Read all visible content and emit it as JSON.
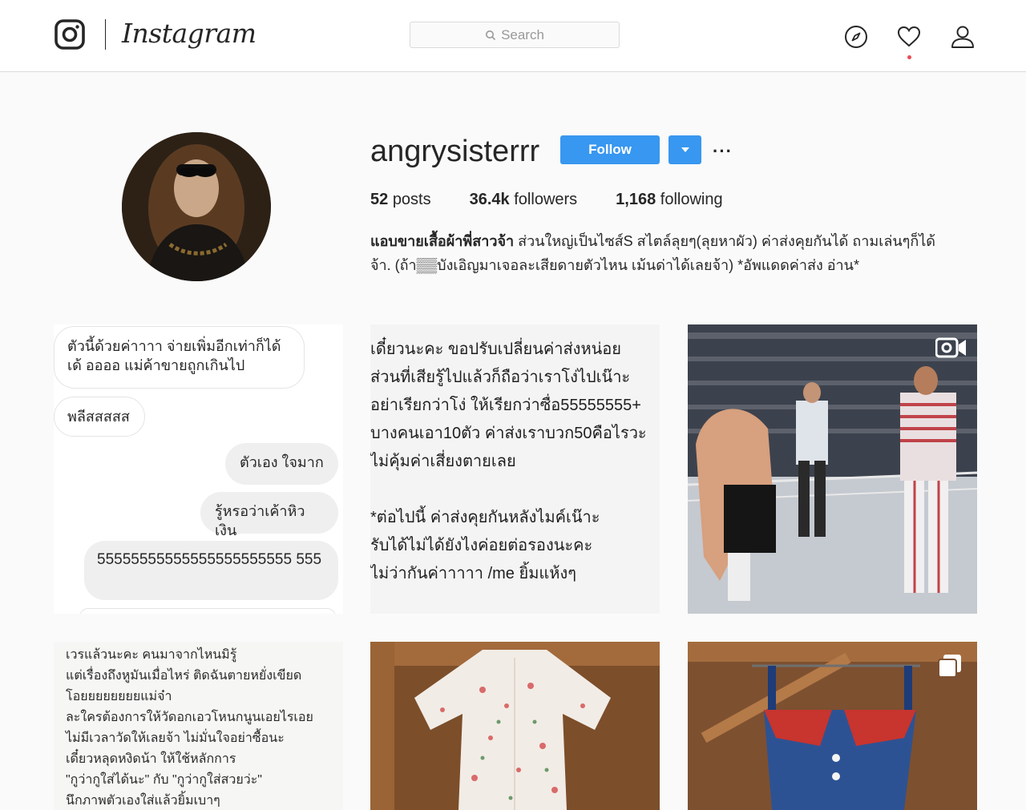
{
  "header": {
    "brand": "Instagram",
    "search_placeholder": "Search",
    "icons": [
      "compass-icon",
      "heart-icon",
      "profile-icon"
    ],
    "accent_color": "#3897f0",
    "notification_color": "#ed4956"
  },
  "profile": {
    "username": "angrysisterrr",
    "follow_label": "Follow",
    "more_label": "···",
    "stats": {
      "posts_count": "52",
      "posts_label": "posts",
      "followers_count": "36.4k",
      "followers_label": "followers",
      "following_count": "1,168",
      "following_label": "following"
    },
    "bio_name": "แอบขายเสื้อผ้าพี่สาวจ้า",
    "bio_line1_rest": " ส่วนใหญ่เป็นไซส์S สไตล์ลุยๆ(ลุยหาผัว) ค่าส่งคุยกันได้ ถามเล่นๆก็ได้",
    "bio_line2": "จ้า. (ถ้า▒▒บังเอิญมาเจอละเสียดายตัวไหน เม้นด่าได้เลยจ้า) *อัพแดดค่าส่ง อ่าน*"
  },
  "posts": {
    "chat": {
      "bubble1": "ตัวนี้ด้วยค่าาาา จ่ายเพิ่มอีกเท่าก็ได้เด้ ออออ แม่ค้าขายถูกเกินไป",
      "bubble2": "พลีสสสสส",
      "bubble3": "ตัวเอง ใจมาก",
      "bubble4": "รู้หรอว่าเค้าหิวเงิน",
      "bubble5": "55555555555555555555555 555"
    },
    "notice_text": "เดี๋ยวนะคะ ขอปรับเปลี่ยนค่าส่งหน่อย\nส่วนที่เสียรู้ไปแล้วก็ถือว่าเราโง่ไปเน๊าะ\nอย่าเรียกว่าโง่ ให้เรียกว่าซื่อ55555555+\nบางคนเอา10ตัว ค่าส่งเราบวก50คือไรวะ\nไม่คุ้มค่าเสี่ยงตายเลย\n\n*ต่อไปนี้ ค่าส่งคุยกันหลังไมค์เน๊าะ\nรับได้ไม่ได้ยังไงค่อยต่อรองนะคะ\nไม่ว่ากันค่าาาาา /me ยิ้มแห้งๆ",
    "poem_text": "เวรแล้วนะคะ คนมาจากไหนมิรู้\nแต่เรื่องถึงหูมันเมื่อไหร่ ติดฉันตายหยั่งเขียด\nโอยยยยยยยยแม่จ๋า\nละใครต้องการให้วัดอกเอวโหนกนูนเอยไรเอย\nไม่มีเวลาวัดให้เลยจ้า ไม่มั่นใจอย่าซื้อนะ\nเดี๋ยวหลุดหงิดน้า ให้ใช้หลักการ\n\"กูว่ากูใส่ได้นะ\" กับ \"กูว่ากูใส่สวยว่ะ\"\nนึกภาพตัวเองใส่แล้วยิ้มเบาๆ"
  }
}
